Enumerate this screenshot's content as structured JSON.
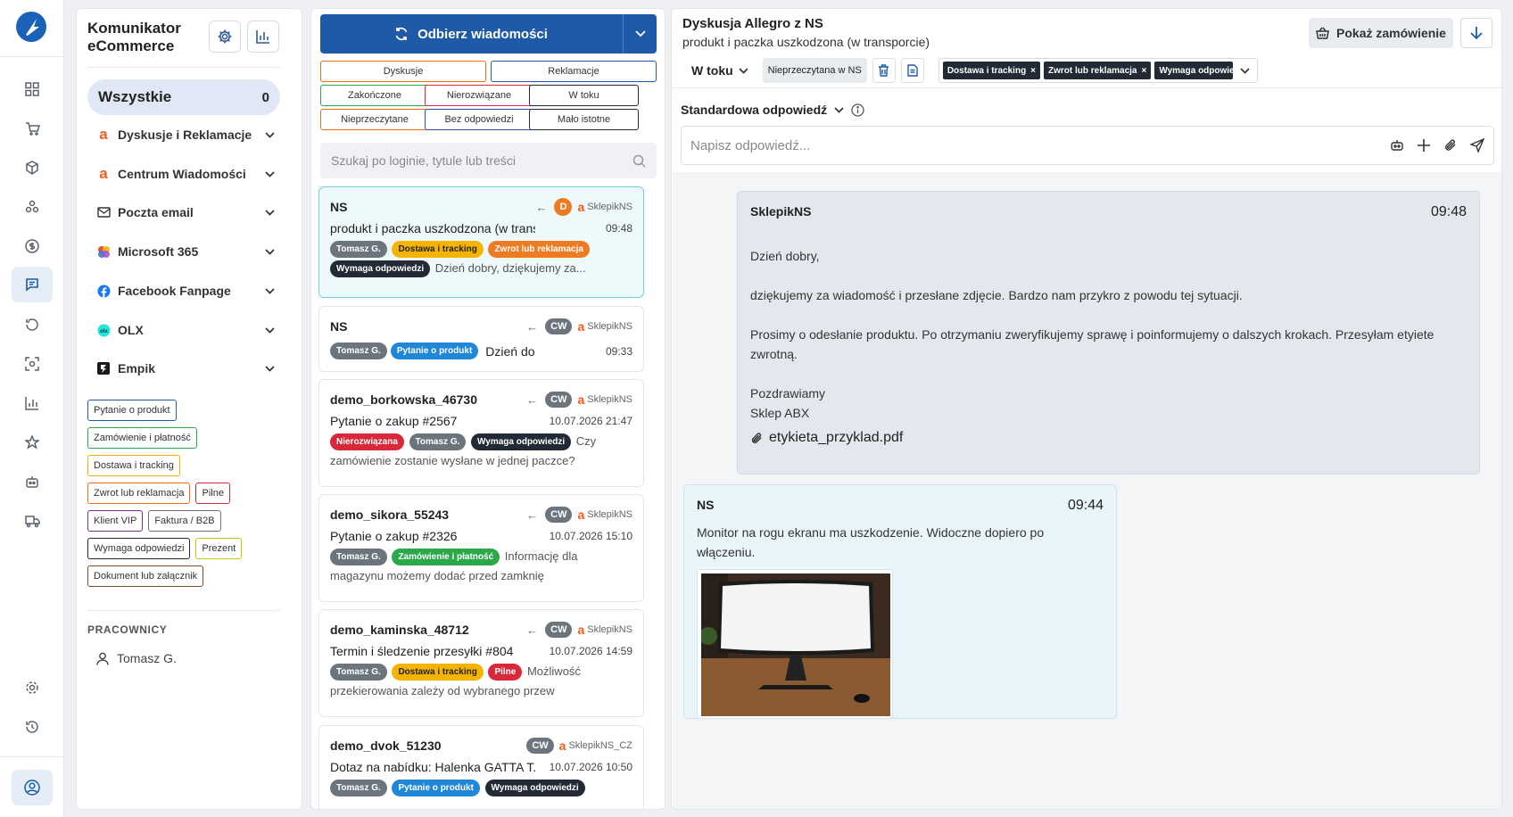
{
  "rail": {
    "items": [
      "dashboard-icon",
      "cart-icon",
      "package-icon",
      "network-icon",
      "dollar-icon",
      "messages-icon",
      "refresh-icon",
      "scan-icon",
      "stats-icon",
      "star-icon",
      "robot-icon",
      "truck-icon"
    ],
    "bottom": [
      "settings-icon",
      "history-icon",
      "account-icon"
    ]
  },
  "sidebar": {
    "title": "Komunikator eCommerce",
    "all_label": "Wszystkie",
    "all_count": "0",
    "channels": [
      {
        "label": "Dyskusje i Reklamacje",
        "icon": "allegro-icon"
      },
      {
        "label": "Centrum Wiadomości",
        "icon": "allegro-icon"
      },
      {
        "label": "Poczta email",
        "icon": "mail-icon"
      },
      {
        "label": "Microsoft 365",
        "icon": "microsoft365-icon"
      },
      {
        "label": "Facebook Fanpage",
        "icon": "facebook-icon"
      },
      {
        "label": "OLX",
        "icon": "olx-icon"
      },
      {
        "label": "Empik",
        "icon": "empik-icon"
      }
    ],
    "tags": [
      {
        "label": "Pytanie o produkt",
        "color": "#1e5aa7"
      },
      {
        "label": "Zamówienie i płatność",
        "color": "#2aa84a"
      },
      {
        "label": "Dostawa i tracking",
        "color": "#f0b400"
      },
      {
        "label": "Zwrot lub reklamacja",
        "color": "#e8701a"
      },
      {
        "label": "Pilne",
        "color": "#d9283a"
      },
      {
        "label": "Klient VIP",
        "color": "#7b2d8e"
      },
      {
        "label": "Faktura / B2B",
        "color": "#6c757d"
      },
      {
        "label": "Wymaga odpowiedzi",
        "color": "#222a35"
      },
      {
        "label": "Prezent",
        "color": "#c8c800"
      },
      {
        "label": "Dokument lub załącznik",
        "color": "#8b4a2b"
      }
    ],
    "workers_heading": "PRACOWNICY",
    "worker": "Tomasz G."
  },
  "list": {
    "fetch_label": "Odbierz wiadomości",
    "filters": [
      {
        "label": "Dyskusje",
        "color": "#e8701a"
      },
      {
        "label": "Reklamacje",
        "color": "#1e5aa7"
      },
      {
        "label": "Zakończone",
        "color": "#2aa84a"
      },
      {
        "label": "Nierozwiązane",
        "color": "#d9283a"
      },
      {
        "label": "W toku",
        "color": "#222a35"
      },
      {
        "label": "Nieprzeczytane",
        "color": "#e8701a"
      },
      {
        "label": "Bez odpowiedzi",
        "color": "#1e5aa7"
      },
      {
        "label": "Mało istotne",
        "color": "#222a35"
      }
    ],
    "search_placeholder": "Szukaj po loginie, tytule lub treści",
    "conversations": [
      {
        "login": "NS",
        "badge": "D",
        "shop": "SklepikNS",
        "subject": "produkt i paczka uszkodzona (w transporcie)",
        "time": "09:48",
        "tags": [
          {
            "t": "Tomasz G.",
            "c": "#6c757d",
            "f": "#fff"
          },
          {
            "t": "Dostawa i tracking",
            "c": "#f5b400",
            "f": "#222"
          },
          {
            "t": "Zwrot lub reklamacja",
            "c": "#ee7b22",
            "f": "#fff"
          },
          {
            "t": "Wymaga odpowiedzi",
            "c": "#222a35",
            "f": "#fff"
          }
        ],
        "preview": "Dzień dobry, dziękujemy za..."
      },
      {
        "login": "NS",
        "badge": "CW",
        "shop": "SklepikNS",
        "subject": "",
        "time": "09:33",
        "tags": [
          {
            "t": "Tomasz G.",
            "c": "#6c757d",
            "f": "#fff"
          },
          {
            "t": "Pytanie o produkt",
            "c": "#1f86d8",
            "f": "#fff"
          }
        ],
        "preview": "Dzień dobry Żar..."
      },
      {
        "login": "demo_borkowska_46730",
        "badge": "CW",
        "shop": "SklepikNS",
        "subject": "Pytanie o zakup #2567",
        "time": "10.07.2026 21:47",
        "tags": [
          {
            "t": "Nierozwiązana",
            "c": "#d9283a",
            "f": "#fff"
          },
          {
            "t": "Tomasz G.",
            "c": "#6c757d",
            "f": "#fff"
          },
          {
            "t": "Wymaga odpowiedzi",
            "c": "#222a35",
            "f": "#fff"
          }
        ],
        "preview": "Czy zamówienie zostanie wysłane w jednej paczce?"
      },
      {
        "login": "demo_sikora_55243",
        "badge": "CW",
        "shop": "SklepikNS",
        "subject": "Pytanie o zakup #2326",
        "time": "10.07.2026 15:10",
        "tags": [
          {
            "t": "Tomasz G.",
            "c": "#6c757d",
            "f": "#fff"
          },
          {
            "t": "Zamówienie i płatność",
            "c": "#2aa84a",
            "f": "#fff"
          }
        ],
        "preview": "Informację dla magazynu możemy dodać przed zamknię"
      },
      {
        "login": "demo_kaminska_48712",
        "badge": "CW",
        "shop": "SklepikNS",
        "subject": "Termin i śledzenie przesyłki #804",
        "time": "10.07.2026 14:59",
        "tags": [
          {
            "t": "Tomasz G.",
            "c": "#6c757d",
            "f": "#fff"
          },
          {
            "t": "Dostawa i tracking",
            "c": "#f5b400",
            "f": "#222"
          },
          {
            "t": "Pilne",
            "c": "#d9283a",
            "f": "#fff"
          }
        ],
        "preview": "Możliwość przekierowania zależy od wybranego przew"
      },
      {
        "login": "demo_dvok_51230",
        "badge": "CW",
        "shop": "SklepikNS_CZ",
        "subject": "Dotaz na nabídku: Halenka GATTA T...",
        "time": "10.07.2026 10:50",
        "tags": [
          {
            "t": "Tomasz G.",
            "c": "#6c757d",
            "f": "#fff"
          },
          {
            "t": "Pytanie o produkt",
            "c": "#1f86d8",
            "f": "#fff"
          },
          {
            "t": "Wymaga odpowiedzi",
            "c": "#222a35",
            "f": "#fff"
          }
        ],
        "preview": ""
      }
    ]
  },
  "detail": {
    "title": "Dyskusja Allegro z NS",
    "subtitle": "produkt i paczka uszkodzona (w transporcie)",
    "show_order_label": "Pokaż zamówienie",
    "status_label": "W toku",
    "read_status": "Nieprzeczytana w NS",
    "tags": [
      "Dostawa i tracking",
      "Zwrot lub reklamacja",
      "Wymaga odpowie"
    ],
    "std_response_label": "Standardowa odpowiedź",
    "reply_placeholder": "Napisz odpowiedź...",
    "messages": [
      {
        "sender": "SklepikNS",
        "time": "09:48",
        "lines": [
          "Dzień dobry,",
          "dziękujemy za wiadomość i przesłane zdjęcie. Bardzo nam przykro z powodu tej sytuacji.",
          "Prosimy o odesłanie produktu. Po otrzymaniu zweryfikujemy sprawę i poinformujemy o dalszych krokach. Przesyłam etyiete zwrotną.",
          "Pozdrawiamy",
          "Sklep ABX"
        ],
        "attachment": "etykieta_przyklad.pdf"
      },
      {
        "sender": "NS",
        "time": "09:44",
        "text": "Monitor na rogu ekranu ma uszkodzenie. Widoczne dopiero po włączeniu."
      }
    ]
  }
}
